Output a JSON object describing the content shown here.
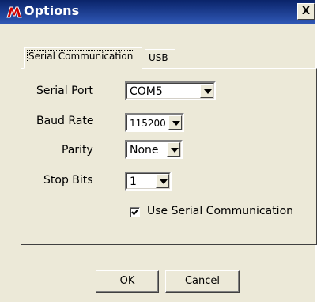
{
  "window": {
    "title": "Options",
    "icon": "microchip-logo-icon",
    "close_label": "X"
  },
  "tabs": [
    {
      "label": "Serial Communication",
      "selected": true
    },
    {
      "label": "USB",
      "selected": false
    }
  ],
  "serial": {
    "port": {
      "label": "Serial Port",
      "value": "COM5"
    },
    "baud": {
      "label": "Baud Rate",
      "value": "115200"
    },
    "parity": {
      "label": "Parity",
      "value": "None"
    },
    "stop_bits": {
      "label": "Stop Bits",
      "value": "1"
    },
    "use_serial": {
      "label": "Use Serial Communication",
      "checked": true
    }
  },
  "buttons": {
    "ok": "OK",
    "cancel": "Cancel"
  },
  "colors": {
    "titlebar": "#0a246a",
    "logo": "#d00000",
    "dialog_bg": "#ece9d8"
  }
}
